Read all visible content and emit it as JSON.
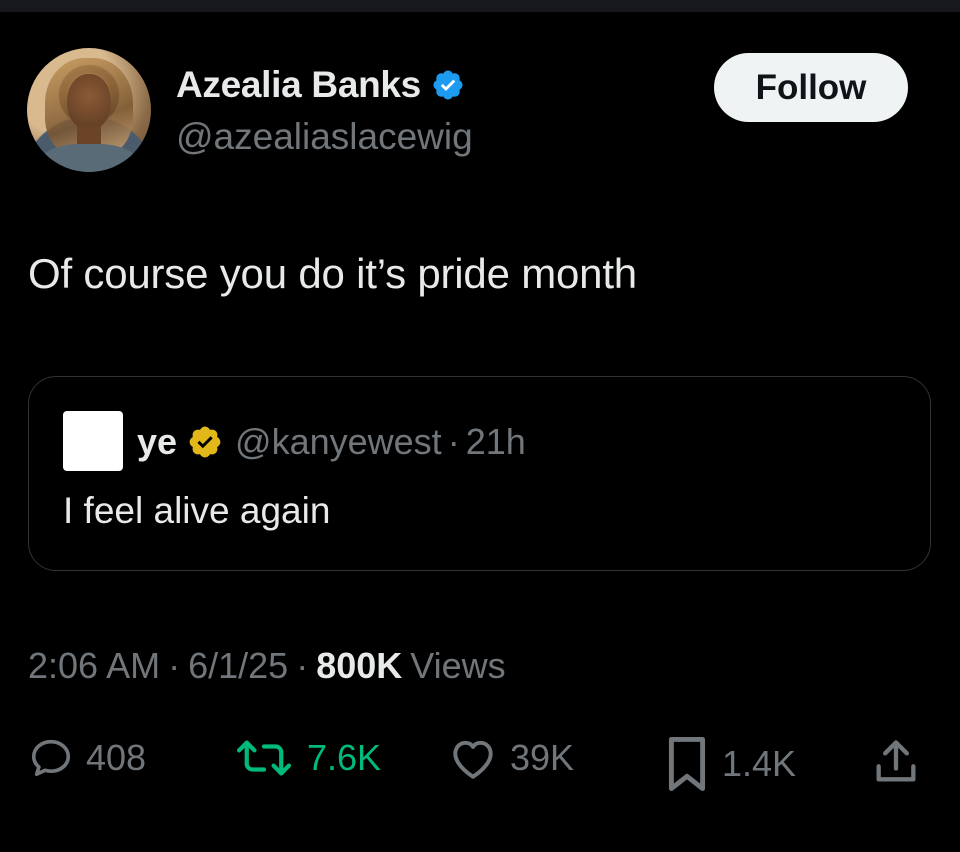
{
  "author": {
    "name": "Azealia Banks",
    "handle": "@azealiaslacewig"
  },
  "follow_label": "Follow",
  "tweet_text": "Of course you do it’s pride month",
  "quote": {
    "name": "ye",
    "handle": "@kanyewest",
    "separator": "·",
    "time": "21h",
    "text": "I feel alive again"
  },
  "meta": {
    "time": "2:06 AM",
    "sep1": "·",
    "date": "6/1/25",
    "sep2": "·",
    "views_count": "800K",
    "views_label": "Views"
  },
  "actions": {
    "replies": "408",
    "reposts": "7.6K",
    "likes": "39K",
    "bookmarks": "1.4K"
  },
  "colors": {
    "background": "#000000",
    "text_primary": "#e7e9ea",
    "text_secondary": "#71767b",
    "verified_blue": "#1d9bf0",
    "verified_gold": "#e2b719",
    "repost_green": "#00ba7c",
    "follow_bg": "#eff3f4"
  },
  "icons": {
    "reply": "reply-icon",
    "repost": "repost-icon",
    "like": "heart-icon",
    "bookmark": "bookmark-icon",
    "share": "share-icon"
  }
}
